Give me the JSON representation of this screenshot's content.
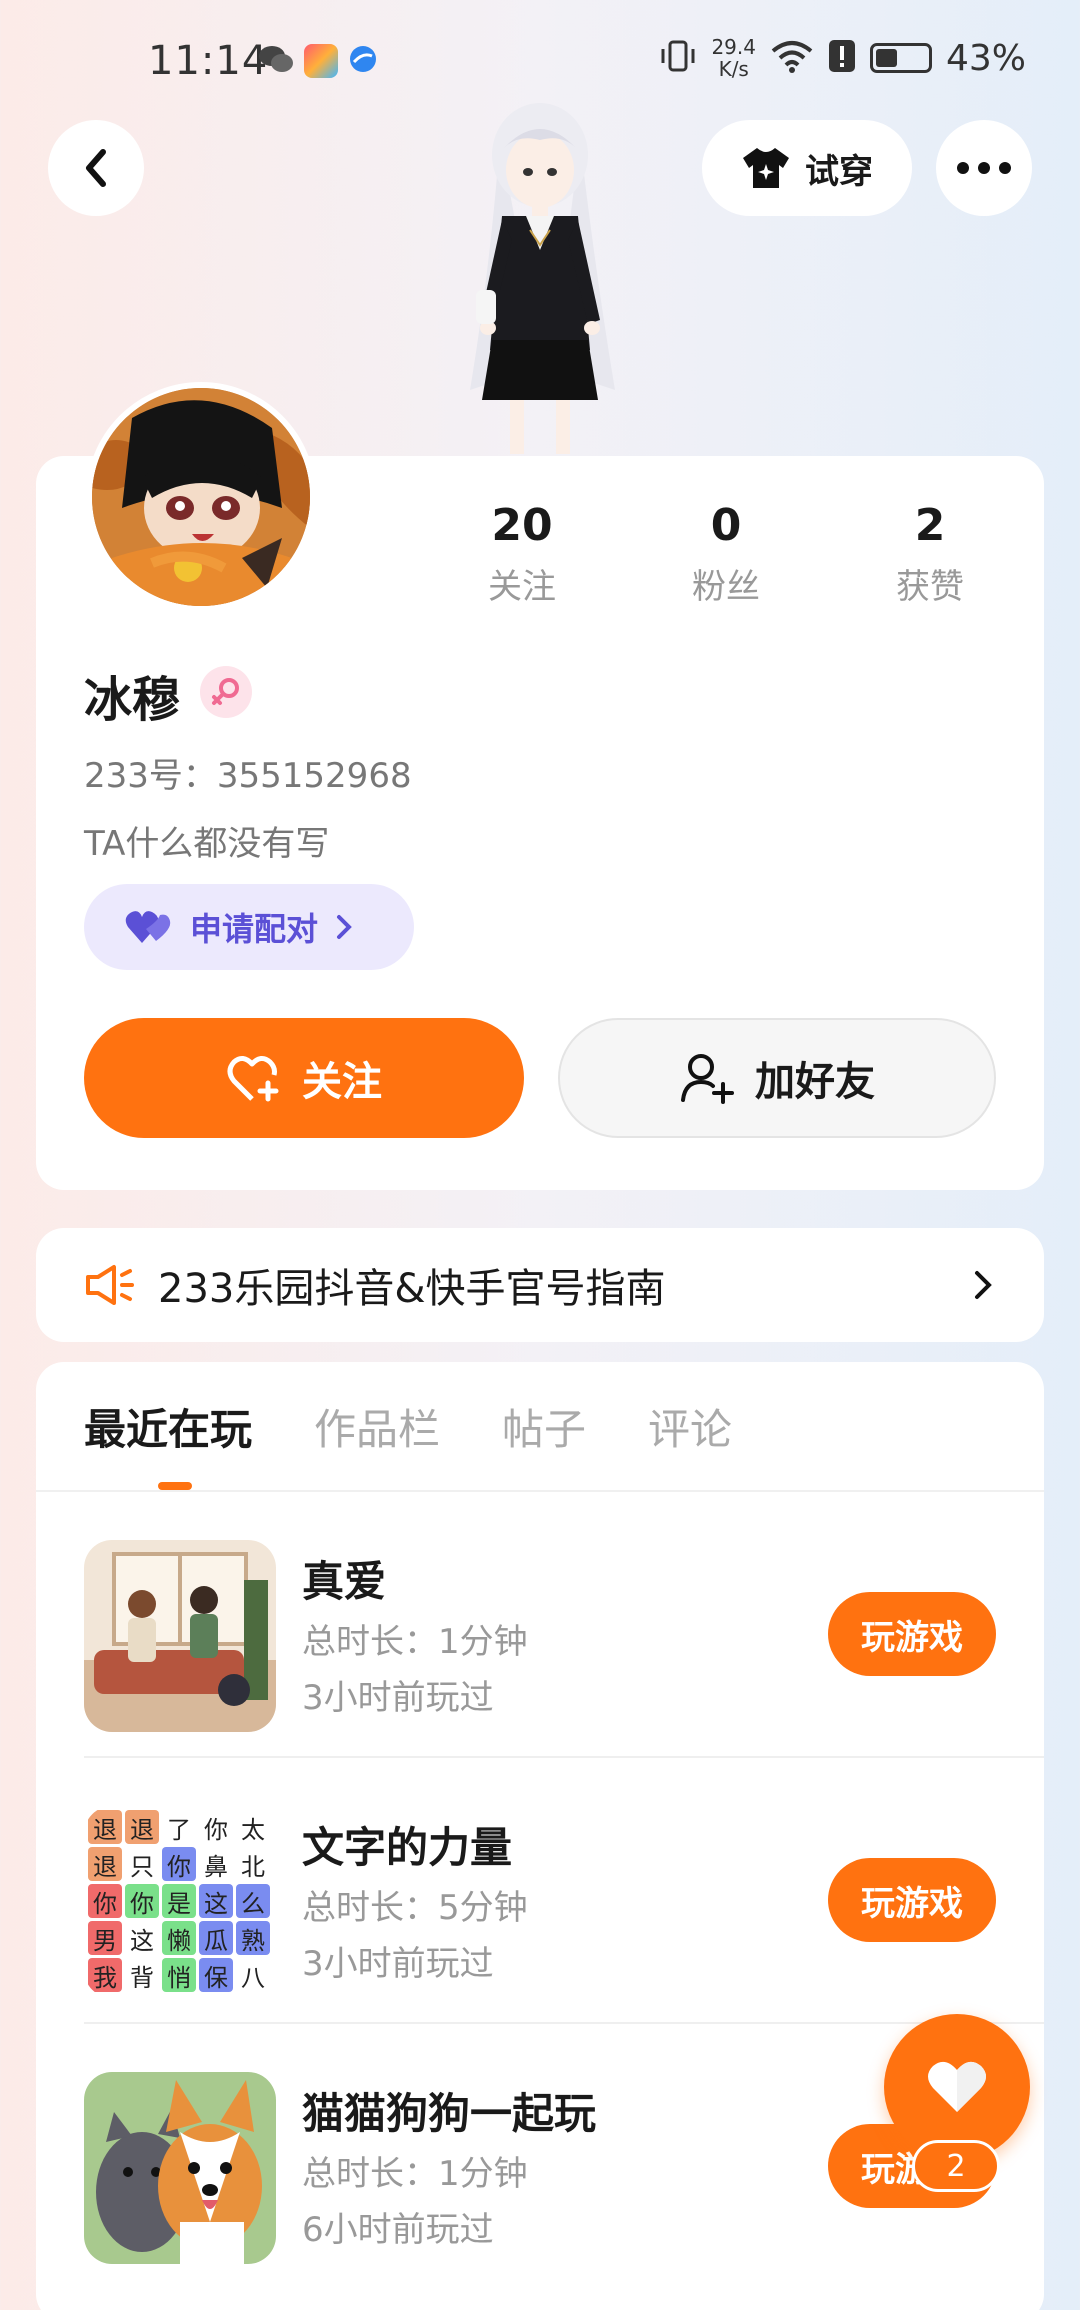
{
  "status_bar": {
    "time": "11:14",
    "net_speed_value": "29.4",
    "net_speed_unit": "K/s",
    "battery_pct": "43%",
    "battery_level": 0.43
  },
  "header": {
    "tryon_label": "试穿"
  },
  "profile": {
    "stats": [
      {
        "value": "20",
        "label": "关注"
      },
      {
        "value": "0",
        "label": "粉丝"
      },
      {
        "value": "2",
        "label": "获赞"
      }
    ],
    "name": "冰穆",
    "uid": "233号：355152968",
    "bio": "TA什么都没有写",
    "pair_label": "申请配对",
    "follow_label": "关注",
    "add_friend_label": "加好友"
  },
  "notice": {
    "text": "233乐园抖音&快手官号指南"
  },
  "tabs": [
    "最近在玩",
    "作品栏",
    "帖子",
    "评论"
  ],
  "games": [
    {
      "title": "真爱",
      "duration": "总时长：1分钟",
      "last_played": "3小时前玩过",
      "button": "玩游戏"
    },
    {
      "title": "文字的力量",
      "duration": "总时长：5分钟",
      "last_played": "3小时前玩过",
      "button": "玩游戏"
    },
    {
      "title": "猫猫狗狗一起玩",
      "duration": "总时长：1分钟",
      "last_played": "6小时前玩过",
      "button": "玩游戏"
    }
  ],
  "word_grid": [
    [
      "退",
      "退",
      "了",
      "你",
      "太"
    ],
    [
      "退",
      "只",
      "你",
      "鼻",
      "北"
    ],
    [
      "你",
      "你",
      "是",
      "这",
      "么"
    ],
    [
      "男",
      "这",
      "懒",
      "瓜",
      "熟"
    ],
    [
      "我",
      "背",
      "悄",
      "保",
      "八"
    ]
  ],
  "fab": {
    "badge": "2"
  },
  "colors": {
    "accent": "#ff7210",
    "pair_purple": "#5b50d6",
    "pair_bg": "#ece9fd",
    "gender_pink": "#f06a92"
  }
}
